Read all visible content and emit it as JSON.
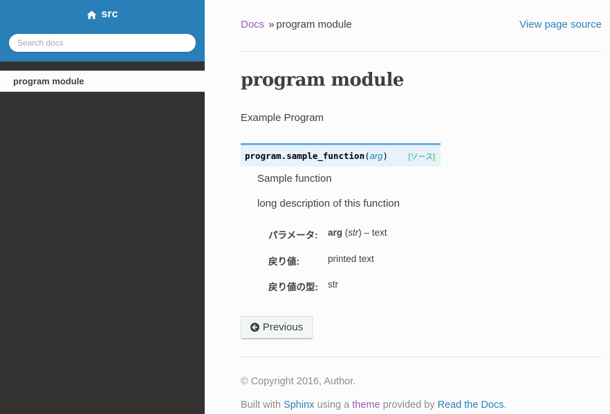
{
  "sidebar": {
    "project_title": "src",
    "search_placeholder": "Search docs",
    "current_item": "program module"
  },
  "breadcrumbs": {
    "root": "Docs",
    "separator": "»",
    "current": "program module",
    "view_source": "View page source"
  },
  "main": {
    "title": "program module",
    "intro": "Example Program",
    "signature": {
      "name": "program.sample_function",
      "open_paren": "(",
      "arg": "arg",
      "close_paren": ")",
      "source_link": "[ソース]"
    },
    "description": [
      "Sample function",
      "long description of this function"
    ],
    "fields": {
      "params": {
        "label": "パラメータ:",
        "arg_name": "arg",
        "arg_type": "str",
        "arg_desc": "– text"
      },
      "returns": {
        "label": "戻り値:",
        "value": "printed text"
      },
      "return_type": {
        "label": "戻り値の型:",
        "value": "str"
      }
    },
    "previous_button": "Previous"
  },
  "footer": {
    "copyright": "© Copyright 2016, Author.",
    "built_prefix": "Built with",
    "sphinx": "Sphinx",
    "using_a": "using a",
    "theme": "theme",
    "provided_by": "provided by",
    "rtd": "Read the Docs",
    "period": "."
  },
  "colors": {
    "accent": "#2980b9",
    "visited_link": "#9b59b6",
    "sidebar_bg": "#343131",
    "source_link": "#27ae60"
  },
  "icons": {
    "home": "home-icon",
    "previous": "circle-arrow-left-icon"
  }
}
